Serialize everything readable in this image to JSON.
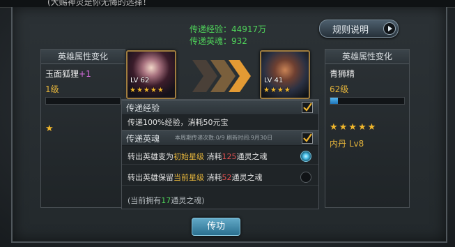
{
  "top_text": "(大赐神灵是你无悔的选择！",
  "info": {
    "exp_line": "传递经验：44917万",
    "soul_line": "传递英魂：932"
  },
  "rules_button": "规则说明",
  "left_hero": {
    "panel_title": "英雄属性变化",
    "name": "玉面狐狸",
    "plus": "+1",
    "level": "1级",
    "exp_fill": 0.0,
    "stars_text": "★",
    "portrait_lv": "LV 62",
    "portrait_stars": "★★★★★"
  },
  "right_hero": {
    "panel_title": "英雄属性变化",
    "name": "青狮精",
    "level": "62级",
    "exp_fill": 0.1,
    "stars_text": "★★★★★",
    "neidan": "内丹 Lv8",
    "portrait_lv": "LV 41",
    "portrait_stars": "★★★★"
  },
  "transfer_exp": {
    "title": "传递经验",
    "desc": "传递100%经验，消耗50元宝",
    "checked": true
  },
  "transfer_soul": {
    "title": "传递英魂",
    "note": "本周期传递次数:0/9 刷新时间:9月30日",
    "checked": true,
    "options": [
      {
        "pre": "转出英雄变为",
        "hl": "初始星级",
        "mid": " 消耗",
        "num": "125",
        "post": "通灵之魂",
        "selected": true
      },
      {
        "pre": "转出英雄保留",
        "hl": "当前星级",
        "mid": " 消耗",
        "num": "52",
        "post": "通灵之魂",
        "selected": false
      }
    ],
    "own_pre": "(当前拥有",
    "own_num": "17",
    "own_post": "通灵之魂)"
  },
  "transfer_button": "传功",
  "colors": {
    "accent_green": "#4fd45a",
    "gold": "#e3b33b",
    "cost_red": "#e25151",
    "plus_purple": "#d86ce0"
  }
}
